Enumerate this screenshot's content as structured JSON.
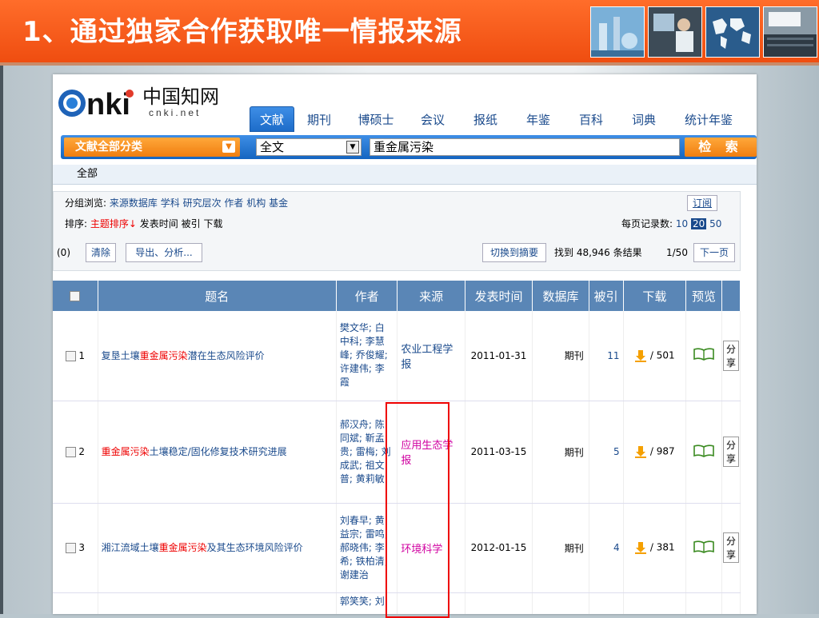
{
  "slide": {
    "title": "1、通过独家合作获取唯一情报来源"
  },
  "thumbnails": [
    "lab-photo",
    "engineer-photo",
    "world-map",
    "lecture-hall-photo"
  ],
  "logo": {
    "brand": "CNKI",
    "cn": "中国知网",
    "domain": "cnki.net"
  },
  "tabs": [
    "文献",
    "期刊",
    "博硕士",
    "会议",
    "报纸",
    "年鉴",
    "百科",
    "词典",
    "统计年鉴"
  ],
  "search": {
    "category": "文献全部分类",
    "field": "全文",
    "query": "重金属污染",
    "button": "检 索"
  },
  "scope": "全部",
  "group": {
    "label": "分组浏览:",
    "items": [
      "来源数据库",
      "学科",
      "研究层次",
      "作者",
      "机构",
      "基金"
    ],
    "subscribe": "订阅"
  },
  "sort": {
    "label": "排序:",
    "items": [
      "主题排序↓",
      "发表时间",
      "被引",
      "下载"
    ],
    "perpage_label": "每页记录数:",
    "perpage": [
      "10",
      "20",
      "50"
    ]
  },
  "actions": {
    "count": "(0)",
    "clear": "清除",
    "export": "导出、分析...",
    "switch": "切换到摘要",
    "found": "找到 48,946 条结果",
    "page": "1/50",
    "next": "下一页"
  },
  "table": {
    "headers": [
      "题名",
      "作者",
      "来源",
      "发表时间",
      "数据库",
      "被引",
      "下载",
      "预览"
    ],
    "rows": [
      {
        "num": "1",
        "title_pre": "复垦土壤",
        "title_hl": "重金属污染",
        "title_post": "潜在生态风险评价",
        "authors": "樊文华; 白中科; 李慧峰; 乔俊耀; 许建伟; 李霞",
        "source": "农业工程学报",
        "date": "2011-01-31",
        "db": "期刊",
        "cited": "11",
        "downloads": "/ 501",
        "share": "分享"
      },
      {
        "num": "2",
        "title_pre": "",
        "title_hl": "重金属污染",
        "title_post": "土壤稳定/固化修复技术研究进展",
        "authors": "郝汉舟; 陈同斌; 靳孟贵; 雷梅; 刘成武; 祖文普; 黄莉敏",
        "source": "应用生态学报",
        "date": "2011-03-15",
        "db": "期刊",
        "cited": "5",
        "downloads": "/ 987",
        "share": "分享"
      },
      {
        "num": "3",
        "title_pre": "湘江流域土壤",
        "title_hl": "重金属污染",
        "title_post": "及其生态环境风险评价",
        "authors": "刘春早; 黄益宗; 雷鸣; 郝晓伟; 李希; 铁柏清; 谢建治",
        "source": "环境科学",
        "date": "2012-01-15",
        "db": "期刊",
        "cited": "4",
        "downloads": "/ 381",
        "share": "分享"
      },
      {
        "num": "",
        "title_pre": "",
        "title_hl": "",
        "title_post": "",
        "authors": "郭笑笑; 刘",
        "source": "",
        "date": "",
        "db": "",
        "cited": "",
        "downloads": "",
        "share": ""
      }
    ]
  },
  "colors": {
    "header_orange": "#ef4d10",
    "nav_blue": "#1d6cc9",
    "highlight_red": "#e00000",
    "source_magenta": "#d000a0"
  }
}
